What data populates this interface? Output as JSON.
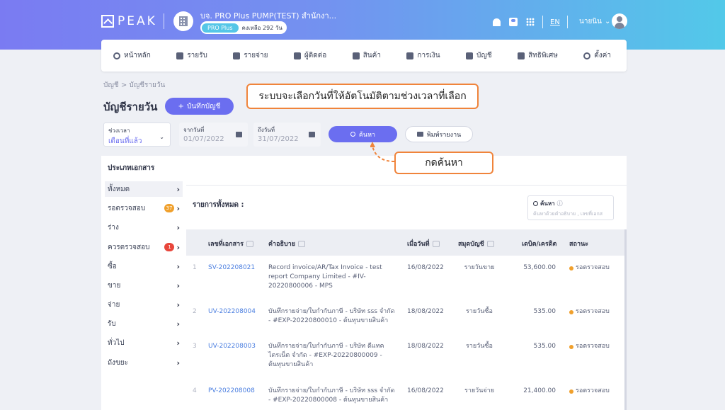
{
  "header": {
    "logo_text": "PEAK",
    "org_name": "บจ. PRO Plus PUMP(TEST) สำนักงา...",
    "plan_badge": "PRO Plus",
    "plan_remaining": "คงเหลือ 292 วัน",
    "lang": "EN",
    "user_name": "นายนิน"
  },
  "nav": {
    "items": [
      {
        "label": "หน้าหลัก",
        "icon": "home-icon"
      },
      {
        "label": "รายรับ",
        "icon": "income-icon"
      },
      {
        "label": "รายจ่าย",
        "icon": "expense-icon"
      },
      {
        "label": "ผู้ติดต่อ",
        "icon": "contact-icon"
      },
      {
        "label": "สินค้า",
        "icon": "product-icon"
      },
      {
        "label": "การเงิน",
        "icon": "money-icon"
      },
      {
        "label": "บัญชี",
        "icon": "account-icon"
      },
      {
        "label": "สิทธิพิเศษ",
        "icon": "privilege-icon"
      },
      {
        "label": "ตั้งค่า",
        "icon": "settings-icon"
      }
    ]
  },
  "breadcrumb": "บัญชี  >  บัญชีรายวัน",
  "page_title": "บัญชีรายวัน",
  "add_button": "บันทึกบัญชี",
  "callouts": {
    "top": "ระบบจะเลือกวันที่ให้อัตโนมัติตามช่วงเวลาที่เลือก",
    "bottom": "กดค้นหา",
    "color": "#f0843b"
  },
  "filters": {
    "range_label": "ช่วงเวลา",
    "range_value": "เดือนที่แล้ว",
    "from_label": "จากวันที่",
    "from_value": "01/07/2022",
    "to_label": "ถึงวันที่",
    "to_value": "31/07/2022",
    "search_button": "ค้นหา",
    "print_button": "พิมพ์รายงาน"
  },
  "sidebar": {
    "title": "ประเภทเอกสาร",
    "items": [
      {
        "label": "ทั้งหมด",
        "badge": ""
      },
      {
        "label": "รอตรวจสอบ",
        "badge": "37",
        "badge_color": "#f0a02c"
      },
      {
        "label": "ร่าง",
        "badge": ""
      },
      {
        "label": "ควรตรวจสอบ",
        "badge": "1",
        "badge_color": "#e8463b"
      },
      {
        "label": "ซื้อ",
        "badge": ""
      },
      {
        "label": "ขาย",
        "badge": ""
      },
      {
        "label": "จ่าย",
        "badge": ""
      },
      {
        "label": "รับ",
        "badge": ""
      },
      {
        "label": "ทั่วไป",
        "badge": ""
      },
      {
        "label": "ถังขยะ",
        "badge": ""
      }
    ]
  },
  "list": {
    "title": "รายการทั้งหมด :",
    "search_label": "ค้นหา",
    "search_placeholder": "ค้นหาด้วยคำอธิบาย , เลขที่เอกส",
    "columns": [
      "เลขที่เอกสาร",
      "คำอธิบาย",
      "เมื่อวันที่",
      "สมุดบัญชี",
      "เดบิต/เครดิต",
      "สถานะ"
    ],
    "rows": [
      {
        "no": "1",
        "doc": "SV-202208021",
        "desc": "Record invoice/AR/Tax Invoice - test report Company Limited - #IV-20220800006 - MPS",
        "date": "16/08/2022",
        "book": "รายวันขาย",
        "amount": "53,600.00",
        "status": "รอตรวจสอบ"
      },
      {
        "no": "2",
        "doc": "UV-202208004",
        "desc": "บันทึกรายจ่าย/ใบกำกับภาษี - บริษัท sss จำกัด - #EXP-20220800010 - ต้นทุนขายสินค้า",
        "date": "18/08/2022",
        "book": "รายวันซื้อ",
        "amount": "535.00",
        "status": "รอตรวจสอบ"
      },
      {
        "no": "3",
        "doc": "UV-202208003",
        "desc": "บันทึกรายจ่าย/ใบกำกับภาษี - บริษัท ดีแทค ไตรเน็ต จำกัด - #EXP-20220800009 - ต้นทุนขายสินค้า",
        "date": "18/08/2022",
        "book": "รายวันซื้อ",
        "amount": "535.00",
        "status": "รอตรวจสอบ"
      },
      {
        "no": "4",
        "doc": "PV-202208008",
        "desc": "บันทึกรายจ่าย/ใบกำกับภาษี - บริษัท sss จำกัด - #EXP-20220800008 - ต้นทุนขายสินค้า",
        "date": "16/08/2022",
        "book": "รายวันจ่าย",
        "amount": "21,400.00",
        "status": "รอตรวจสอบ"
      }
    ]
  }
}
